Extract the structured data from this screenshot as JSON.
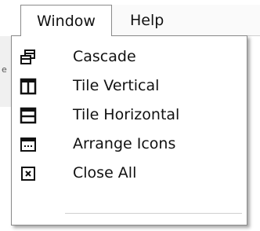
{
  "menubar": {
    "window_label": "Window",
    "help_label": "Help"
  },
  "left_edge": {
    "text": "e"
  },
  "window_menu": {
    "items": [
      {
        "label": "Cascade",
        "icon": "cascade-icon"
      },
      {
        "label": "Tile Vertical",
        "icon": "tile-vertical-icon"
      },
      {
        "label": "Tile Horizontal",
        "icon": "tile-horizontal-icon"
      },
      {
        "label": "Arrange Icons",
        "icon": "arrange-icons-icon"
      },
      {
        "label": "Close All",
        "icon": "close-all-icon"
      }
    ]
  }
}
